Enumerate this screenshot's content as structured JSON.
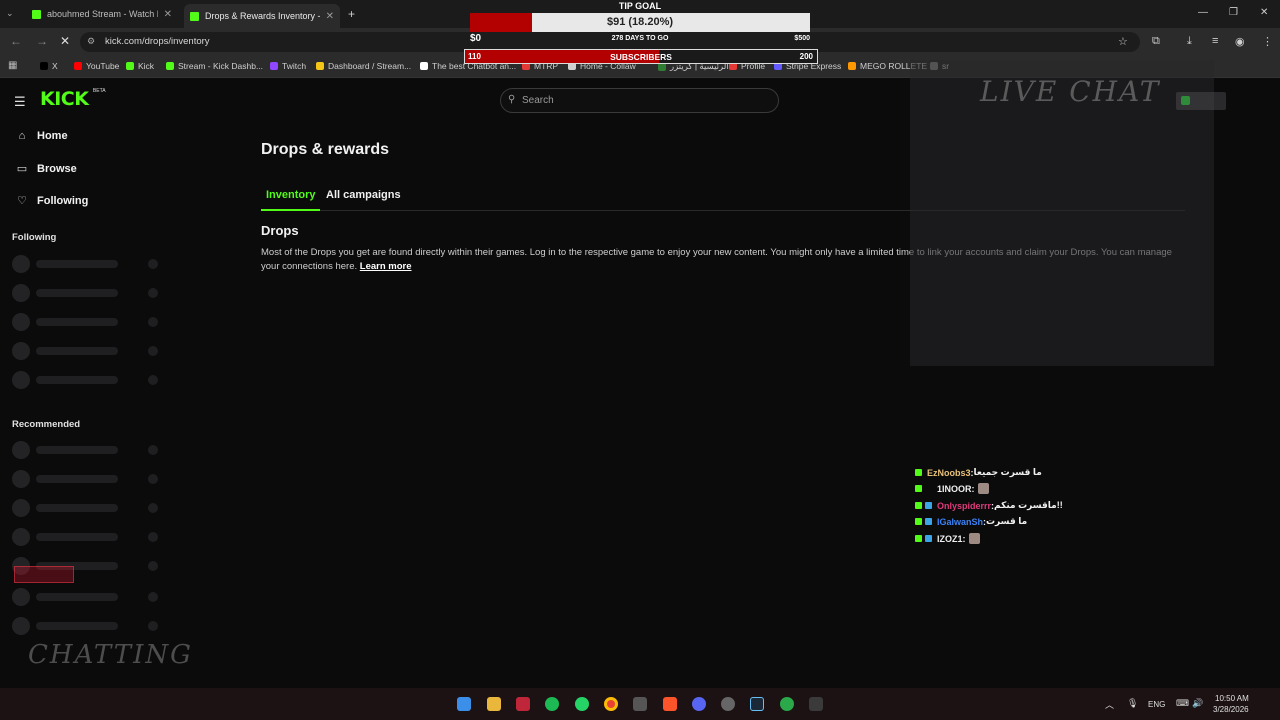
{
  "browser": {
    "tabs": [
      {
        "title": "abouhmed Stream - Watch Live",
        "active": false
      },
      {
        "title": "Drops & Rewards Inventory - K",
        "active": true
      }
    ],
    "url": "kick.com/drops/inventory",
    "bookmarks": [
      {
        "label": "X",
        "color": "#000000"
      },
      {
        "label": "YouTube",
        "color": "#ff0000"
      },
      {
        "label": "Kick",
        "color": "#53fc18"
      },
      {
        "label": "Stream - Kick Dashb...",
        "color": "#53fc18"
      },
      {
        "label": "Twitch",
        "color": "#9146ff"
      },
      {
        "label": "Dashboard / Stream...",
        "color": "#f5c518"
      },
      {
        "label": "The best Chatbot an...",
        "color": "#ffffff"
      },
      {
        "label": "MTRP",
        "color": "#e53935"
      },
      {
        "label": "Home - Collaw",
        "color": "#d0d0d0"
      },
      {
        "label": "الرئيسية | كريتزر",
        "color": "#2e7d32"
      },
      {
        "label": "Profile",
        "color": "#e53935"
      },
      {
        "label": "Stripe Express",
        "color": "#635bff"
      },
      {
        "label": "MEGO ROLLETE",
        "color": "#ff9800"
      },
      {
        "label": "sr",
        "color": "#888888"
      }
    ]
  },
  "tip_goal": {
    "title": "TIP GOAL",
    "amount": "$91 (18.20%)",
    "progress_fraction": 0.182,
    "min": "$0",
    "days": "278 DAYS TO GO",
    "max": "$500"
  },
  "sub_goal": {
    "current": "110",
    "label": "SUBSCRIBERS",
    "goal": "200",
    "progress_fraction": 0.55
  },
  "site": {
    "logo": "KICK",
    "logo_tag": "BETA",
    "search_placeholder": "Search"
  },
  "sidebar": {
    "nav": [
      {
        "label": "Home",
        "icon": "home-icon"
      },
      {
        "label": "Browse",
        "icon": "browse-icon"
      },
      {
        "label": "Following",
        "icon": "heart-icon"
      }
    ],
    "following_heading": "Following",
    "recommended_heading": "Recommended"
  },
  "main": {
    "title": "Drops & rewards",
    "tabs": [
      {
        "label": "Inventory",
        "active": true
      },
      {
        "label": "All campaigns",
        "active": false
      }
    ],
    "section_title": "Drops",
    "description": "Most of the Drops you get are found directly within their games. Log in to the respective game to enjoy your new content. You might only have a limited time to link your accounts and claim your Drops. You can manage your connections here.",
    "learn_more": "Learn more"
  },
  "overlay": {
    "live_chat_title": "LIVE CHAT",
    "chatting_title": "CHATTING",
    "chat_messages": [
      {
        "user": "EzNoobs3",
        "color": "#e8c27a",
        "text": "ما قسرت جميعا"
      },
      {
        "user": "1INOOR",
        "color": "#f0f0f0",
        "text": ""
      },
      {
        "user": "Onlyspiderrr",
        "color": "#e03a7a",
        "text": "ماقسرت منكم!!"
      },
      {
        "user": "IGalwanSh",
        "color": "#3b82f6",
        "text": "ما قسرت"
      },
      {
        "user": "IZOZ1",
        "color": "#f0f0f0",
        "text": ""
      }
    ]
  },
  "taskbar": {
    "language": "ENG",
    "time": "10:50 AM",
    "date": "3/28/2026"
  }
}
